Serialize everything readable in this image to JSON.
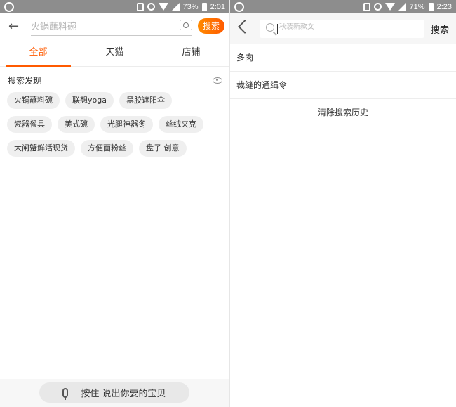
{
  "left_screen": {
    "status": {
      "battery_percent": "73%",
      "time": "2:01"
    },
    "search": {
      "placeholder": "火锅蘸料碗",
      "button_label": "搜索"
    },
    "tabs": [
      {
        "label": "全部",
        "active": true
      },
      {
        "label": "天猫",
        "active": false
      },
      {
        "label": "店铺",
        "active": false
      }
    ],
    "discover": {
      "title": "搜索发现",
      "chips": [
        "火锅蘸料碗",
        "联想yoga",
        "黑胶遮阳伞",
        "瓷器餐具",
        "美式碗",
        "光腿神器冬",
        "丝绒夹克",
        "大闸蟹鲜活现货",
        "方便面粉丝",
        "盘子 创意"
      ]
    },
    "voice": {
      "label": "按住 说出你要的宝贝"
    }
  },
  "right_screen": {
    "status": {
      "battery_percent": "71%",
      "time": "2:23"
    },
    "search": {
      "placeholder": "秋装新款女",
      "button_label": "搜索"
    },
    "history": {
      "items": [
        "多肉",
        "裁缝的通缉令"
      ],
      "clear_label": "清除搜索历史"
    }
  },
  "colors": {
    "accent": "#ff5a00",
    "status_bar": "#8d8d8d"
  }
}
